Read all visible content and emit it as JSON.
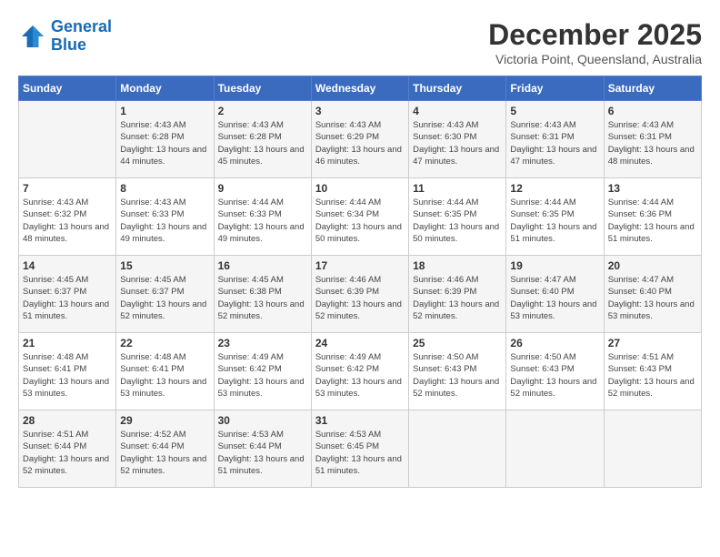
{
  "logo": {
    "line1": "General",
    "line2": "Blue"
  },
  "title": "December 2025",
  "subtitle": "Victoria Point, Queensland, Australia",
  "header": {
    "days": [
      "Sunday",
      "Monday",
      "Tuesday",
      "Wednesday",
      "Thursday",
      "Friday",
      "Saturday"
    ]
  },
  "weeks": [
    [
      {
        "day": "",
        "sunrise": "",
        "sunset": "",
        "daylight": ""
      },
      {
        "day": "1",
        "sunrise": "Sunrise: 4:43 AM",
        "sunset": "Sunset: 6:28 PM",
        "daylight": "Daylight: 13 hours and 44 minutes."
      },
      {
        "day": "2",
        "sunrise": "Sunrise: 4:43 AM",
        "sunset": "Sunset: 6:28 PM",
        "daylight": "Daylight: 13 hours and 45 minutes."
      },
      {
        "day": "3",
        "sunrise": "Sunrise: 4:43 AM",
        "sunset": "Sunset: 6:29 PM",
        "daylight": "Daylight: 13 hours and 46 minutes."
      },
      {
        "day": "4",
        "sunrise": "Sunrise: 4:43 AM",
        "sunset": "Sunset: 6:30 PM",
        "daylight": "Daylight: 13 hours and 47 minutes."
      },
      {
        "day": "5",
        "sunrise": "Sunrise: 4:43 AM",
        "sunset": "Sunset: 6:31 PM",
        "daylight": "Daylight: 13 hours and 47 minutes."
      },
      {
        "day": "6",
        "sunrise": "Sunrise: 4:43 AM",
        "sunset": "Sunset: 6:31 PM",
        "daylight": "Daylight: 13 hours and 48 minutes."
      }
    ],
    [
      {
        "day": "7",
        "sunrise": "Sunrise: 4:43 AM",
        "sunset": "Sunset: 6:32 PM",
        "daylight": "Daylight: 13 hours and 48 minutes."
      },
      {
        "day": "8",
        "sunrise": "Sunrise: 4:43 AM",
        "sunset": "Sunset: 6:33 PM",
        "daylight": "Daylight: 13 hours and 49 minutes."
      },
      {
        "day": "9",
        "sunrise": "Sunrise: 4:44 AM",
        "sunset": "Sunset: 6:33 PM",
        "daylight": "Daylight: 13 hours and 49 minutes."
      },
      {
        "day": "10",
        "sunrise": "Sunrise: 4:44 AM",
        "sunset": "Sunset: 6:34 PM",
        "daylight": "Daylight: 13 hours and 50 minutes."
      },
      {
        "day": "11",
        "sunrise": "Sunrise: 4:44 AM",
        "sunset": "Sunset: 6:35 PM",
        "daylight": "Daylight: 13 hours and 50 minutes."
      },
      {
        "day": "12",
        "sunrise": "Sunrise: 4:44 AM",
        "sunset": "Sunset: 6:35 PM",
        "daylight": "Daylight: 13 hours and 51 minutes."
      },
      {
        "day": "13",
        "sunrise": "Sunrise: 4:44 AM",
        "sunset": "Sunset: 6:36 PM",
        "daylight": "Daylight: 13 hours and 51 minutes."
      }
    ],
    [
      {
        "day": "14",
        "sunrise": "Sunrise: 4:45 AM",
        "sunset": "Sunset: 6:37 PM",
        "daylight": "Daylight: 13 hours and 51 minutes."
      },
      {
        "day": "15",
        "sunrise": "Sunrise: 4:45 AM",
        "sunset": "Sunset: 6:37 PM",
        "daylight": "Daylight: 13 hours and 52 minutes."
      },
      {
        "day": "16",
        "sunrise": "Sunrise: 4:45 AM",
        "sunset": "Sunset: 6:38 PM",
        "daylight": "Daylight: 13 hours and 52 minutes."
      },
      {
        "day": "17",
        "sunrise": "Sunrise: 4:46 AM",
        "sunset": "Sunset: 6:39 PM",
        "daylight": "Daylight: 13 hours and 52 minutes."
      },
      {
        "day": "18",
        "sunrise": "Sunrise: 4:46 AM",
        "sunset": "Sunset: 6:39 PM",
        "daylight": "Daylight: 13 hours and 52 minutes."
      },
      {
        "day": "19",
        "sunrise": "Sunrise: 4:47 AM",
        "sunset": "Sunset: 6:40 PM",
        "daylight": "Daylight: 13 hours and 53 minutes."
      },
      {
        "day": "20",
        "sunrise": "Sunrise: 4:47 AM",
        "sunset": "Sunset: 6:40 PM",
        "daylight": "Daylight: 13 hours and 53 minutes."
      }
    ],
    [
      {
        "day": "21",
        "sunrise": "Sunrise: 4:48 AM",
        "sunset": "Sunset: 6:41 PM",
        "daylight": "Daylight: 13 hours and 53 minutes."
      },
      {
        "day": "22",
        "sunrise": "Sunrise: 4:48 AM",
        "sunset": "Sunset: 6:41 PM",
        "daylight": "Daylight: 13 hours and 53 minutes."
      },
      {
        "day": "23",
        "sunrise": "Sunrise: 4:49 AM",
        "sunset": "Sunset: 6:42 PM",
        "daylight": "Daylight: 13 hours and 53 minutes."
      },
      {
        "day": "24",
        "sunrise": "Sunrise: 4:49 AM",
        "sunset": "Sunset: 6:42 PM",
        "daylight": "Daylight: 13 hours and 53 minutes."
      },
      {
        "day": "25",
        "sunrise": "Sunrise: 4:50 AM",
        "sunset": "Sunset: 6:43 PM",
        "daylight": "Daylight: 13 hours and 52 minutes."
      },
      {
        "day": "26",
        "sunrise": "Sunrise: 4:50 AM",
        "sunset": "Sunset: 6:43 PM",
        "daylight": "Daylight: 13 hours and 52 minutes."
      },
      {
        "day": "27",
        "sunrise": "Sunrise: 4:51 AM",
        "sunset": "Sunset: 6:43 PM",
        "daylight": "Daylight: 13 hours and 52 minutes."
      }
    ],
    [
      {
        "day": "28",
        "sunrise": "Sunrise: 4:51 AM",
        "sunset": "Sunset: 6:44 PM",
        "daylight": "Daylight: 13 hours and 52 minutes."
      },
      {
        "day": "29",
        "sunrise": "Sunrise: 4:52 AM",
        "sunset": "Sunset: 6:44 PM",
        "daylight": "Daylight: 13 hours and 52 minutes."
      },
      {
        "day": "30",
        "sunrise": "Sunrise: 4:53 AM",
        "sunset": "Sunset: 6:44 PM",
        "daylight": "Daylight: 13 hours and 51 minutes."
      },
      {
        "day": "31",
        "sunrise": "Sunrise: 4:53 AM",
        "sunset": "Sunset: 6:45 PM",
        "daylight": "Daylight: 13 hours and 51 minutes."
      },
      {
        "day": "",
        "sunrise": "",
        "sunset": "",
        "daylight": ""
      },
      {
        "day": "",
        "sunrise": "",
        "sunset": "",
        "daylight": ""
      },
      {
        "day": "",
        "sunrise": "",
        "sunset": "",
        "daylight": ""
      }
    ]
  ]
}
